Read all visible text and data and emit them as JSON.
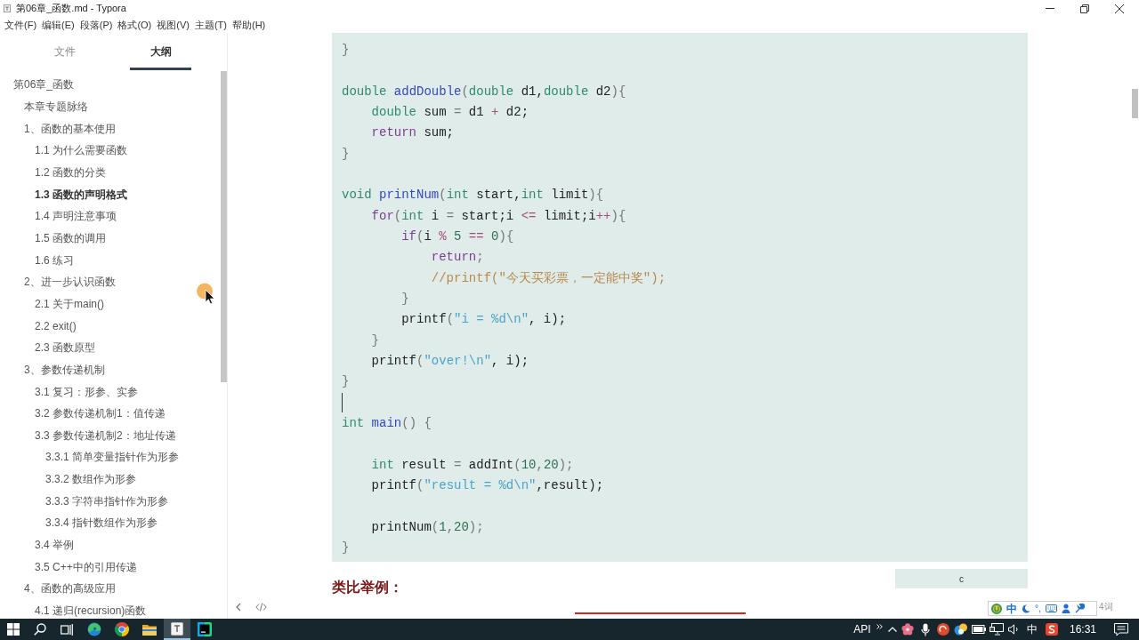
{
  "window": {
    "title": "第06章_函数.md - Typora"
  },
  "menu": [
    "文件(F)",
    "编辑(E)",
    "段落(P)",
    "格式(O)",
    "视图(V)",
    "主题(T)",
    "帮助(H)"
  ],
  "sidebar": {
    "tabs": [
      {
        "label": "文件",
        "selected": false
      },
      {
        "label": "大纲",
        "selected": true
      }
    ],
    "outline": [
      {
        "label": "第06章_函数",
        "selected": false,
        "children": [
          {
            "label": "本章专题脉络",
            "selected": false
          },
          {
            "label": "1、函数的基本使用",
            "selected": false,
            "children": [
              {
                "label": "1.1 为什么需要函数",
                "selected": false
              },
              {
                "label": "1.2 函数的分类",
                "selected": false
              },
              {
                "label": "1.3 函数的声明格式",
                "selected": true
              },
              {
                "label": "1.4 声明注意事项",
                "selected": false
              },
              {
                "label": "1.5 函数的调用",
                "selected": false
              },
              {
                "label": "1.6 练习",
                "selected": false
              }
            ]
          },
          {
            "label": "2、进一步认识函数",
            "selected": false,
            "children": [
              {
                "label": "2.1 关于main()",
                "selected": false
              },
              {
                "label": "2.2 exit()",
                "selected": false
              },
              {
                "label": "2.3 函数原型",
                "selected": false
              }
            ]
          },
          {
            "label": "3、参数传递机制",
            "selected": false,
            "children": [
              {
                "label": "3.1 复习：形参、实参",
                "selected": false
              },
              {
                "label": "3.2 参数传递机制1：值传递",
                "selected": false
              },
              {
                "label": "3.3 参数传递机制2：地址传递",
                "selected": false,
                "children": [
                  {
                    "label": "3.3.1 简单变量指针作为形参",
                    "selected": false
                  },
                  {
                    "label": "3.3.2 数组作为形参",
                    "selected": false
                  },
                  {
                    "label": "3.3.3 字符串指针作为形参",
                    "selected": false
                  },
                  {
                    "label": "3.3.4 指针数组作为形参",
                    "selected": false
                  }
                ]
              },
              {
                "label": "3.4 举例",
                "selected": false
              },
              {
                "label": "3.5 C++中的引用传递",
                "selected": false
              }
            ]
          },
          {
            "label": "4、函数的高级应用",
            "selected": false,
            "children": [
              {
                "label": "4.1 递归(recursion)函数",
                "selected": false
              }
            ]
          }
        ]
      }
    ]
  },
  "editor": {
    "code_block": {
      "language": "c",
      "lines": [
        {
          "kind": "code",
          "caret": false,
          "tokens": [
            {
              "text": "}",
              "kind": "punct"
            }
          ]
        },
        {
          "kind": "blank",
          "caret": false
        },
        {
          "kind": "code",
          "caret": false,
          "tokens": [
            {
              "text": "double",
              "kind": "type"
            },
            {
              "text": " addDouble",
              "kind": "function"
            },
            {
              "text": "(",
              "kind": "punct"
            },
            {
              "text": "double",
              "kind": "type"
            },
            {
              "text": " d1,",
              "kind": "plain"
            },
            {
              "text": "double",
              "kind": "type"
            },
            {
              "text": " d2",
              "kind": "plain"
            },
            {
              "text": "){",
              "kind": "punct"
            }
          ]
        },
        {
          "kind": "code",
          "caret": false,
          "tokens": [
            {
              "text": "    double",
              "kind": "type"
            },
            {
              "text": " sum ",
              "kind": "plain"
            },
            {
              "text": "=",
              "kind": "punct"
            },
            {
              "text": " d1 ",
              "kind": "plain"
            },
            {
              "text": "+",
              "kind": "operator"
            },
            {
              "text": " d2;",
              "kind": "plain"
            }
          ]
        },
        {
          "kind": "code",
          "caret": false,
          "tokens": [
            {
              "text": "    return",
              "kind": "keyword"
            },
            {
              "text": " sum;",
              "kind": "plain"
            }
          ]
        },
        {
          "kind": "code",
          "caret": false,
          "tokens": [
            {
              "text": "}",
              "kind": "punct"
            }
          ]
        },
        {
          "kind": "blank",
          "caret": false
        },
        {
          "kind": "code",
          "caret": false,
          "tokens": [
            {
              "text": "void",
              "kind": "type"
            },
            {
              "text": " printNum",
              "kind": "function"
            },
            {
              "text": "(",
              "kind": "punct"
            },
            {
              "text": "int",
              "kind": "type"
            },
            {
              "text": " start,",
              "kind": "plain"
            },
            {
              "text": "int",
              "kind": "type"
            },
            {
              "text": " limit",
              "kind": "plain"
            },
            {
              "text": "){",
              "kind": "punct"
            }
          ]
        },
        {
          "kind": "code",
          "caret": false,
          "tokens": [
            {
              "text": "    for",
              "kind": "keyword"
            },
            {
              "text": "(",
              "kind": "punct"
            },
            {
              "text": "int",
              "kind": "type"
            },
            {
              "text": " i ",
              "kind": "plain"
            },
            {
              "text": "=",
              "kind": "punct"
            },
            {
              "text": " start;i ",
              "kind": "plain"
            },
            {
              "text": "<=",
              "kind": "operator"
            },
            {
              "text": " limit;i",
              "kind": "plain"
            },
            {
              "text": "++",
              "kind": "operator"
            },
            {
              "text": "){",
              "kind": "punct"
            }
          ]
        },
        {
          "kind": "code",
          "caret": false,
          "tokens": [
            {
              "text": "        if",
              "kind": "keyword"
            },
            {
              "text": "(",
              "kind": "punct"
            },
            {
              "text": "i ",
              "kind": "plain"
            },
            {
              "text": "%",
              "kind": "operator"
            },
            {
              "text": " 5",
              "kind": "number"
            },
            {
              "text": " ==",
              "kind": "operator"
            },
            {
              "text": " 0",
              "kind": "number"
            },
            {
              "text": "){",
              "kind": "punct"
            }
          ]
        },
        {
          "kind": "code",
          "caret": false,
          "tokens": [
            {
              "text": "            return",
              "kind": "keyword"
            },
            {
              "text": ";",
              "kind": "punct"
            }
          ]
        },
        {
          "kind": "code",
          "caret": false,
          "tokens": [
            {
              "text": "            //printf(\"今天买彩票，一定能中奖\");",
              "kind": "comment"
            }
          ]
        },
        {
          "kind": "code",
          "caret": false,
          "tokens": [
            {
              "text": "        }",
              "kind": "punct"
            }
          ]
        },
        {
          "kind": "code",
          "caret": false,
          "tokens": [
            {
              "text": "        printf",
              "kind": "plain"
            },
            {
              "text": "(",
              "kind": "punct"
            },
            {
              "text": "\"i = %d\\n\"",
              "kind": "string"
            },
            {
              "text": ", i);",
              "kind": "plain"
            }
          ]
        },
        {
          "kind": "code",
          "caret": false,
          "tokens": [
            {
              "text": "    }",
              "kind": "punct"
            }
          ]
        },
        {
          "kind": "code",
          "caret": false,
          "tokens": [
            {
              "text": "    printf",
              "kind": "plain"
            },
            {
              "text": "(",
              "kind": "punct"
            },
            {
              "text": "\"over!\\n\"",
              "kind": "string"
            },
            {
              "text": ", i);",
              "kind": "plain"
            }
          ]
        },
        {
          "kind": "code",
          "caret": false,
          "tokens": [
            {
              "text": "}",
              "kind": "punct"
            }
          ]
        },
        {
          "kind": "blank",
          "caret": true
        },
        {
          "kind": "code",
          "caret": false,
          "tokens": [
            {
              "text": "int",
              "kind": "type"
            },
            {
              "text": " main",
              "kind": "function"
            },
            {
              "text": "() {",
              "kind": "punct"
            }
          ]
        },
        {
          "kind": "blank",
          "caret": false
        },
        {
          "kind": "code",
          "caret": false,
          "tokens": [
            {
              "text": "    int",
              "kind": "type"
            },
            {
              "text": " result ",
              "kind": "plain"
            },
            {
              "text": "=",
              "kind": "punct"
            },
            {
              "text": " addInt",
              "kind": "plain"
            },
            {
              "text": "(",
              "kind": "punct"
            },
            {
              "text": "10",
              "kind": "number"
            },
            {
              "text": ",",
              "kind": "punct"
            },
            {
              "text": "20",
              "kind": "number"
            },
            {
              "text": ");",
              "kind": "punct"
            }
          ]
        },
        {
          "kind": "code",
          "caret": false,
          "tokens": [
            {
              "text": "    printf",
              "kind": "plain"
            },
            {
              "text": "(",
              "kind": "punct"
            },
            {
              "text": "\"result = %d\\n\"",
              "kind": "string"
            },
            {
              "text": ",result);",
              "kind": "plain"
            }
          ]
        },
        {
          "kind": "blank",
          "caret": false
        },
        {
          "kind": "code",
          "caret": false,
          "tokens": [
            {
              "text": "    printNum",
              "kind": "plain"
            },
            {
              "text": "(",
              "kind": "punct"
            },
            {
              "text": "1",
              "kind": "number"
            },
            {
              "text": ",",
              "kind": "punct"
            },
            {
              "text": "20",
              "kind": "number"
            },
            {
              "text": ");",
              "kind": "punct"
            }
          ]
        },
        {
          "kind": "code",
          "caret": false,
          "tokens": [
            {
              "text": "}",
              "kind": "punct"
            }
          ]
        }
      ]
    },
    "heading": "类比举例：",
    "word_count": "4词"
  },
  "ime_toolbar": {
    "mode": "中",
    "punctuation": "°,"
  },
  "taskbar": {
    "apps": [
      {
        "kind": "start",
        "selected": false
      },
      {
        "kind": "search",
        "selected": false
      },
      {
        "kind": "taskview",
        "selected": false
      },
      {
        "kind": "swirl",
        "selected": false
      },
      {
        "kind": "orb",
        "selected": false
      },
      {
        "kind": "folder",
        "selected": false
      },
      {
        "kind": "document",
        "selected": true
      },
      {
        "kind": "ide",
        "selected": false
      }
    ],
    "tray": {
      "label": "API",
      "input_mode": "中",
      "time": "16:31"
    }
  }
}
